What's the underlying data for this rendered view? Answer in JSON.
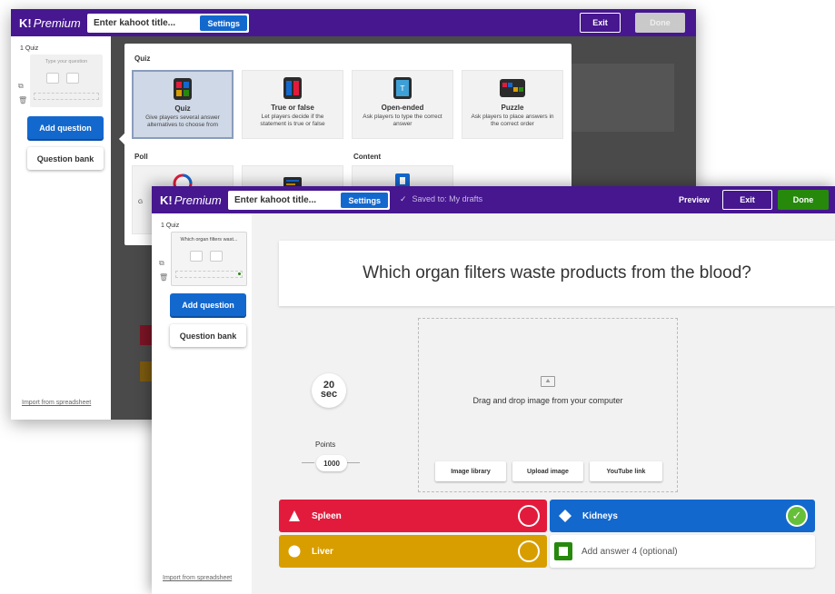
{
  "back_window": {
    "brand_mark": "K!",
    "brand_text": "Premium",
    "title_placeholder": "Enter kahoot title...",
    "settings_label": "Settings",
    "exit_label": "Exit",
    "done_label": "Done",
    "sidebar": {
      "item_label": "1  Quiz",
      "card_placeholder": "Type your question",
      "add_question_label": "Add question",
      "question_bank_label": "Question bank",
      "import_label": "Import from spreadsheet"
    },
    "popup": {
      "section_quiz": "Quiz",
      "section_poll": "Poll",
      "section_content": "Content",
      "types": [
        {
          "name": "Quiz",
          "desc": "Give players several answer alternatives to choose from"
        },
        {
          "name": "True or false",
          "desc": "Let players decide if the statement is true or false"
        },
        {
          "name": "Open-ended",
          "desc": "Ask players to type the correct answer"
        },
        {
          "name": "Puzzle",
          "desc": "Ask players to place answers in the correct order"
        }
      ],
      "poll_partial_label": "G"
    }
  },
  "front_window": {
    "brand_mark": "K!",
    "brand_text": "Premium",
    "title_placeholder": "Enter kahoot title...",
    "settings_label": "Settings",
    "saved_status": "Saved to: My drafts",
    "preview_label": "Preview",
    "exit_label": "Exit",
    "done_label": "Done",
    "sidebar": {
      "item_label": "1  Quiz",
      "card_text": "Which organ filters wast...",
      "add_question_label": "Add question",
      "question_bank_label": "Question bank",
      "import_label": "Import from spreadsheet"
    },
    "question": "Which organ filters waste products from the blood?",
    "timer_value": "20",
    "timer_unit": "sec",
    "points_label": "Points",
    "points_value": "1000",
    "media": {
      "drop_text": "Drag and drop image from your computer",
      "buttons": [
        "Image library",
        "Upload image",
        "YouTube link"
      ]
    },
    "answers": [
      {
        "text": "Spleen",
        "shape": "triangle-icon",
        "color": "#e21b3c",
        "correct": false
      },
      {
        "text": "Kidneys",
        "shape": "diamond-icon",
        "color": "#1368ce",
        "correct": true
      },
      {
        "text": "Liver",
        "shape": "circle-icon",
        "color": "#d89e00",
        "correct": false
      },
      {
        "text": "Add answer 4 (optional)",
        "shape": "square-icon",
        "color": "#26890c",
        "correct": false
      }
    ]
  },
  "colors": {
    "topbar": "#46178f",
    "blue": "#1368ce",
    "green": "#26890c",
    "red": "#e21b3c",
    "yellow": "#d89e00"
  }
}
